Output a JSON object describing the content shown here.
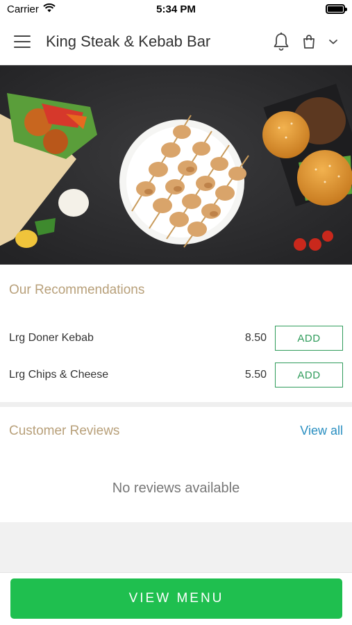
{
  "status_bar": {
    "carrier": "Carrier",
    "time": "5:34 PM"
  },
  "header": {
    "title": "King Steak & Kebab Bar"
  },
  "recommendations": {
    "title": "Our Recommendations",
    "items": [
      {
        "name": "Lrg Doner Kebab",
        "price": "8.50",
        "action": "ADD"
      },
      {
        "name": "Lrg Chips & Cheese",
        "price": "5.50",
        "action": "ADD"
      }
    ]
  },
  "reviews": {
    "title": "Customer Reviews",
    "view_all": "View all",
    "empty_text": "No reviews available"
  },
  "footer": {
    "view_menu_label": "VIEW MENU"
  },
  "colors": {
    "accent_green": "#1fbf4f",
    "add_green": "#2e9b5a",
    "section_gold": "#b8a07a",
    "link_blue": "#2a8fc1"
  },
  "icons": [
    "wifi-icon",
    "battery-icon",
    "menu-icon",
    "bell-icon",
    "cart-icon",
    "chevron-down-icon"
  ]
}
